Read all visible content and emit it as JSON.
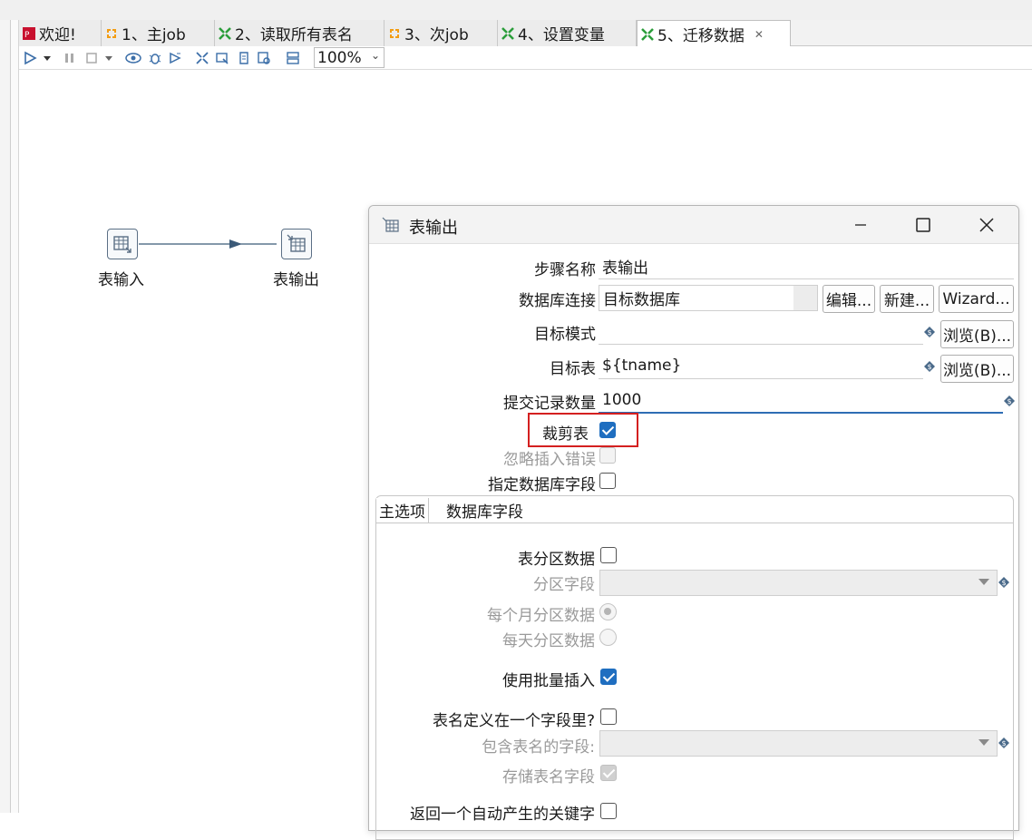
{
  "editor": {
    "tabs": [
      {
        "label": "欢迎!",
        "icon": "pentaho-logo-icon",
        "color": "#c8102e"
      },
      {
        "label": "1、主job",
        "icon": "job-icon",
        "color": "#f39c12"
      },
      {
        "label": "2、读取所有表名",
        "icon": "transformation-icon",
        "color": "#2a9d3a"
      },
      {
        "label": "3、次job",
        "icon": "job-icon",
        "color": "#f39c12"
      },
      {
        "label": "4、设置变量",
        "icon": "transformation-icon",
        "color": "#2a9d3a"
      },
      {
        "label": "5、迁移数据",
        "icon": "transformation-icon",
        "color": "#2a9d3a",
        "active": true
      }
    ],
    "toolbar": {
      "zoom": "100%"
    }
  },
  "canvas": {
    "nodes": [
      {
        "label": "表输入",
        "icon": "table-input-icon"
      },
      {
        "label": "表输出",
        "icon": "table-output-icon"
      }
    ]
  },
  "dialog": {
    "title": "表输出",
    "step_name_label": "步骤名称",
    "step_name_value": "表输出",
    "db_conn_label": "数据库连接",
    "db_conn_value": "目标数据库",
    "edit_btn": "编辑...",
    "new_btn": "新建...",
    "wizard_btn": "Wizard...",
    "schema_label": "目标模式",
    "schema_value": "",
    "browse_btn": "浏览(B)...",
    "table_label": "目标表",
    "table_value": "${tname}",
    "commit_label": "提交记录数量",
    "commit_value": "1000",
    "truncate_label": "裁剪表",
    "truncate_checked": true,
    "ignore_errors_label": "忽略插入错误",
    "specify_fields_label": "指定数据库字段",
    "tabs": [
      "主选项",
      "数据库字段"
    ],
    "partition_label": "表分区数据",
    "partition_field_label": "分区字段",
    "monthly_label": "每个月分区数据",
    "daily_label": "每天分区数据",
    "batch_label": "使用批量插入",
    "batch_checked": true,
    "table_in_field_label": "表名定义在一个字段里?",
    "field_containing_table_label": "包含表名的字段:",
    "store_table_field_label": "存储表名字段",
    "return_key_label": "返回一个自动产生的关键字"
  }
}
